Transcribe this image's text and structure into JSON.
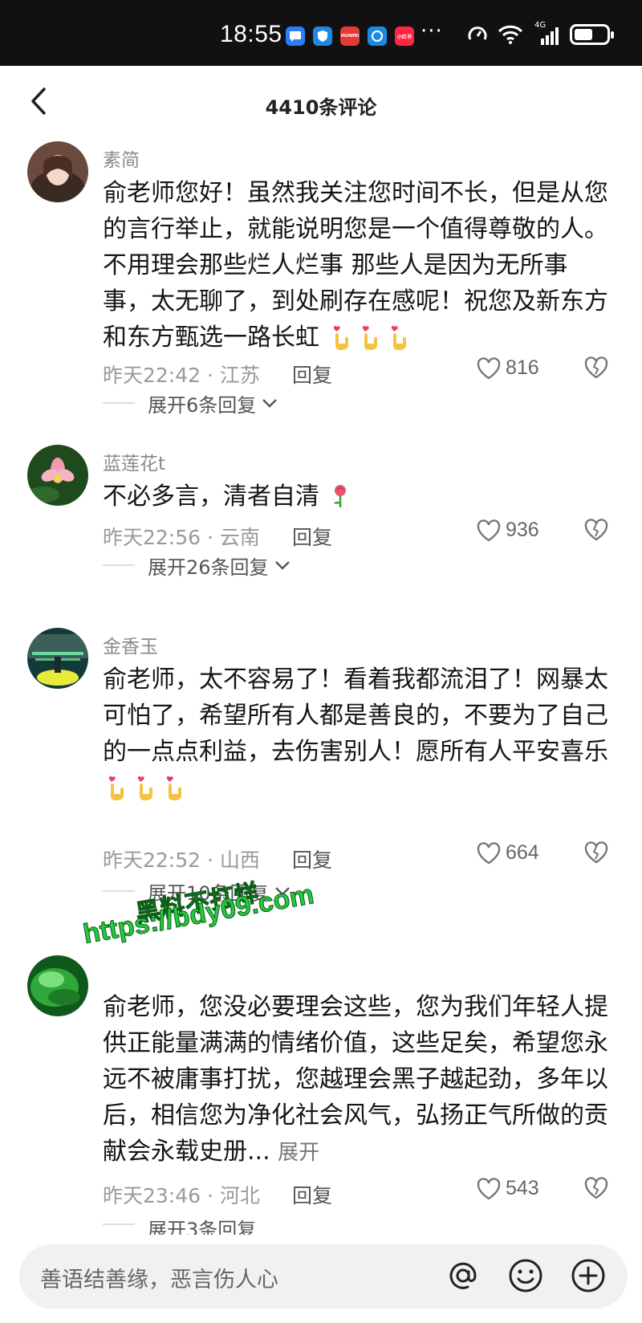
{
  "status_bar": {
    "time": "18:55",
    "network_label": "4G",
    "app_icons": [
      "message-app-icon",
      "shield-app-icon",
      "huawei-app-icon",
      "browser-app-icon",
      "xiaohongshu-app-icon"
    ],
    "app_icon_labels": [
      "",
      "",
      "HUAWEI",
      "",
      "小红书"
    ],
    "more": "···"
  },
  "header": {
    "title": "4410条评论"
  },
  "comments": [
    {
      "username": "素简",
      "text": "俞老师您好！虽然我关注您时间不长，但是从您的言行举止，就能说明您是一个值得尊敬的人。不用理会那些烂人烂事 那些人是因为无所事事，太无聊了，到处刷存在感呢！祝您及新东方和东方甄选一路长虹",
      "emoji_count": 3,
      "time_location": "昨天22:42 · 江苏",
      "reply_label": "回复",
      "likes": "816",
      "expand_label": "展开6条回复"
    },
    {
      "username": "蓝莲花t",
      "text": "不必多言，清者自清",
      "emoji_count": 1,
      "time_location": "昨天22:56 · 云南",
      "reply_label": "回复",
      "likes": "936",
      "expand_label": "展开26条回复"
    },
    {
      "username": "金香玉",
      "text": "俞老师，太不容易了！看着我都流泪了！网暴太可怕了，希望所有人都是善良的，不要为了自己的一点点利益，去伤害别人！愿所有人平安喜乐",
      "emoji_count": 3,
      "time_location": "昨天22:52 · 山西",
      "reply_label": "回复",
      "likes": "664",
      "expand_label": "展开10条回复"
    },
    {
      "username": "",
      "text": "俞老师，您没必要理会这些，您为我们年轻人提供正能量满满的情绪价值，这些足矣，希望您永远不被庸事打扰，您越理会黑子越起劲，多年以后，相信您为净化社会风气，弘扬正气所做的贡献会永载史册...",
      "more_label": "展开",
      "time_location": "昨天23:46 · 河北",
      "reply_label": "回复",
      "likes": "543",
      "expand_label": "展开3条回复"
    }
  ],
  "watermark": {
    "line1": "黑料不打烊",
    "line2": "https://bdy09.com"
  },
  "input": {
    "placeholder": "善语结善缘，恶言伤人心"
  },
  "colors": {
    "status_bar_bg": "#111111",
    "watermark_green": "#27c93f"
  }
}
